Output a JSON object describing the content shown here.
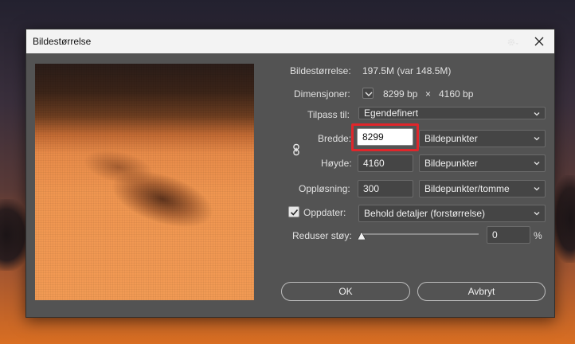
{
  "dialog": {
    "title": "Bildestørrelse"
  },
  "info": {
    "size_label": "Bildestørrelse:",
    "size_value": "197.5M (var 148.5M)",
    "dim_label": "Dimensjoner:",
    "dim_w": "8299 bp",
    "dim_x": "×",
    "dim_h": "4160 bp"
  },
  "fit": {
    "label": "Tilpass til:",
    "value": "Egendefinert"
  },
  "width": {
    "label": "Bredde:",
    "value": "8299",
    "unit": "Bildepunkter"
  },
  "height": {
    "label": "Høyde:",
    "value": "4160",
    "unit": "Bildepunkter"
  },
  "resolution": {
    "label": "Oppløsning:",
    "value": "300",
    "unit": "Bildepunkter/tomme"
  },
  "resample": {
    "label": "Oppdater:",
    "checked": true,
    "value": "Behold detaljer (forstørrelse)"
  },
  "noise": {
    "label": "Reduser støy:",
    "value": "0",
    "unit": "%",
    "level": 0
  },
  "buttons": {
    "ok": "OK",
    "cancel": "Avbryt"
  },
  "icons": [
    "close-icon",
    "gear-icon",
    "link-icon",
    "checkbox-check-icon",
    "chevron-down-icon"
  ],
  "colors": {
    "dialog_bg": "#535353",
    "highlight": "#e0262b"
  }
}
